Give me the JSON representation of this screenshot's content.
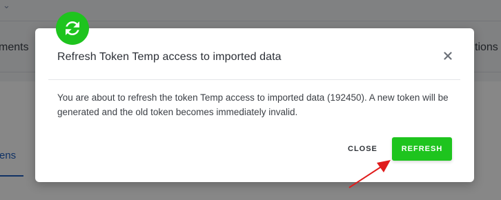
{
  "background": {
    "left_tab_fragment": "ments",
    "right_tab_fragment": "tions",
    "subtab_fragment": "ens"
  },
  "dialog": {
    "icon": "refresh-icon",
    "title": "Refresh Token Temp access to imported data",
    "body": "You are about to refresh the token Temp access to imported data (192450). A new token will be generated and the old token becomes immediately invalid.",
    "close_icon": "close-icon",
    "close_label": "CLOSE",
    "refresh_label": "REFRESH"
  },
  "colors": {
    "accent_green": "#1ec41e",
    "annotation_red": "#e01b1b"
  }
}
